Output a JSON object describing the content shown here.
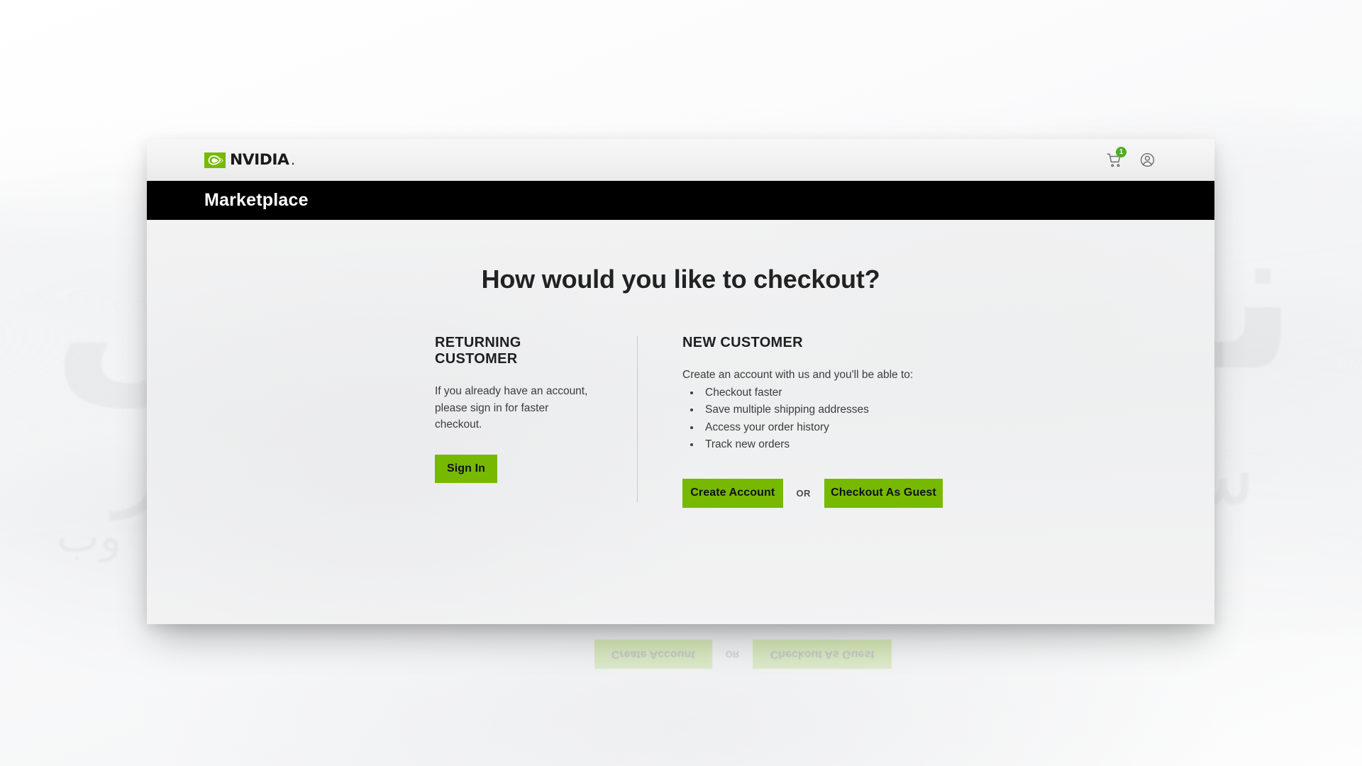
{
  "brand": {
    "logo_text": "NVIDIA",
    "logo_suffix": ".",
    "accent_green": "#76b900",
    "badge_green": "#4caf1e",
    "bar_black": "#000000"
  },
  "header": {
    "cart_icon": "shopping-cart-icon",
    "cart_badge_count": "1",
    "account_icon": "user-account-icon"
  },
  "marketplace_bar": {
    "title": "Marketplace"
  },
  "main": {
    "heading": "How would you like to checkout?",
    "returning": {
      "title": "RETURNING CUSTOMER",
      "description": "If you already have an account, please sign in for faster checkout.",
      "sign_in_label": "Sign In"
    },
    "new": {
      "title": "NEW CUSTOMER",
      "description": "Create an account with us and you'll be able to:",
      "benefits": [
        "Checkout faster",
        "Save multiple shipping addresses",
        "Access your order history",
        "Track new orders"
      ],
      "create_account_label": "Create Account",
      "or_label": "OR",
      "checkout_guest_label": "Checkout As Guest"
    }
  }
}
